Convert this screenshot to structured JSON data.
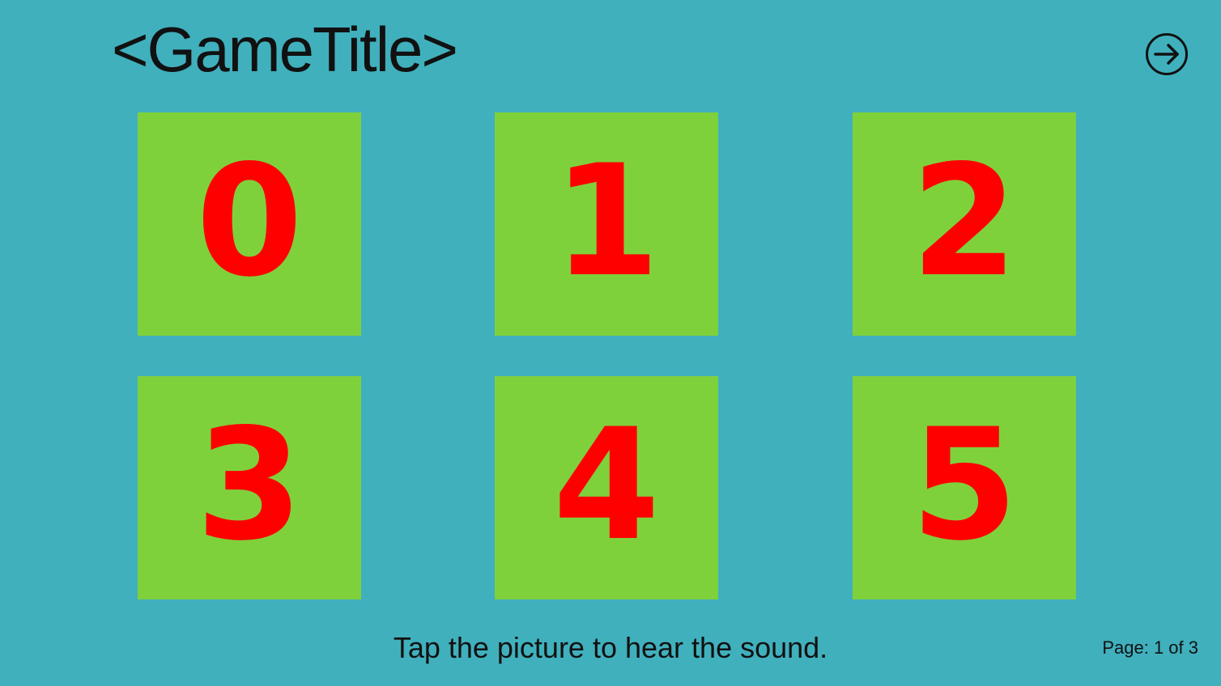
{
  "header": {
    "title": "<GameTitle>"
  },
  "navigation": {
    "next_icon": "arrow-right-circle-icon"
  },
  "tiles": [
    {
      "label": "0"
    },
    {
      "label": "1"
    },
    {
      "label": "2"
    },
    {
      "label": "3"
    },
    {
      "label": "4"
    },
    {
      "label": "5"
    }
  ],
  "footer": {
    "instruction": "Tap the picture to hear the sound.",
    "page": "Page: 1 of 3"
  },
  "colors": {
    "background": "#40b0bd",
    "tile": "#7fd13b",
    "digit": "#ff0000"
  }
}
